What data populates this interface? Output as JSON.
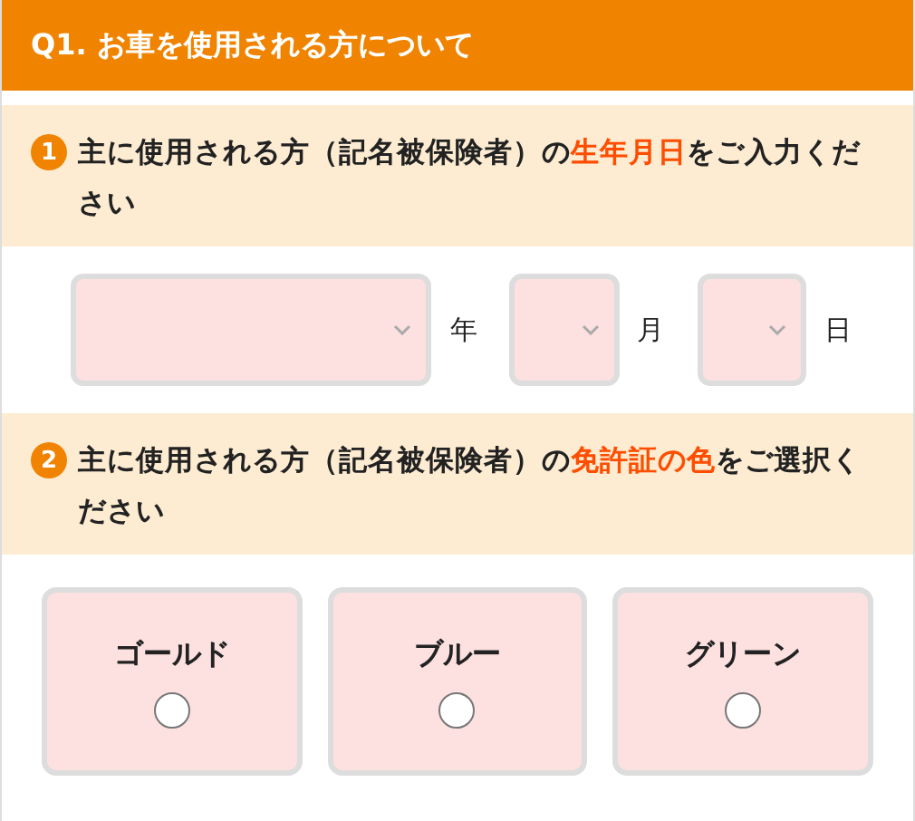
{
  "header": {
    "title": "Q1. お車を使用される方について"
  },
  "questions": [
    {
      "number": "1",
      "kind": "date",
      "parts": [
        {
          "text": "主に使用される方（記名被保険者）の",
          "highlight": false
        },
        {
          "text": "生年月日",
          "highlight": true
        },
        {
          "text": "をご入力ください",
          "highlight": false
        }
      ],
      "fields": [
        {
          "unit": "年"
        },
        {
          "unit": "月"
        },
        {
          "unit": "日"
        }
      ]
    },
    {
      "number": "2",
      "kind": "choice",
      "parts": [
        {
          "text": "主に使用される方（記名被保険者）の",
          "highlight": false
        },
        {
          "text": "免許証の色",
          "highlight": true
        },
        {
          "text": "をご選択ください",
          "highlight": false
        }
      ],
      "options": [
        {
          "label": "ゴールド",
          "selected": false
        },
        {
          "label": "ブルー",
          "selected": false
        },
        {
          "label": "グリーン",
          "selected": false
        }
      ]
    }
  ]
}
